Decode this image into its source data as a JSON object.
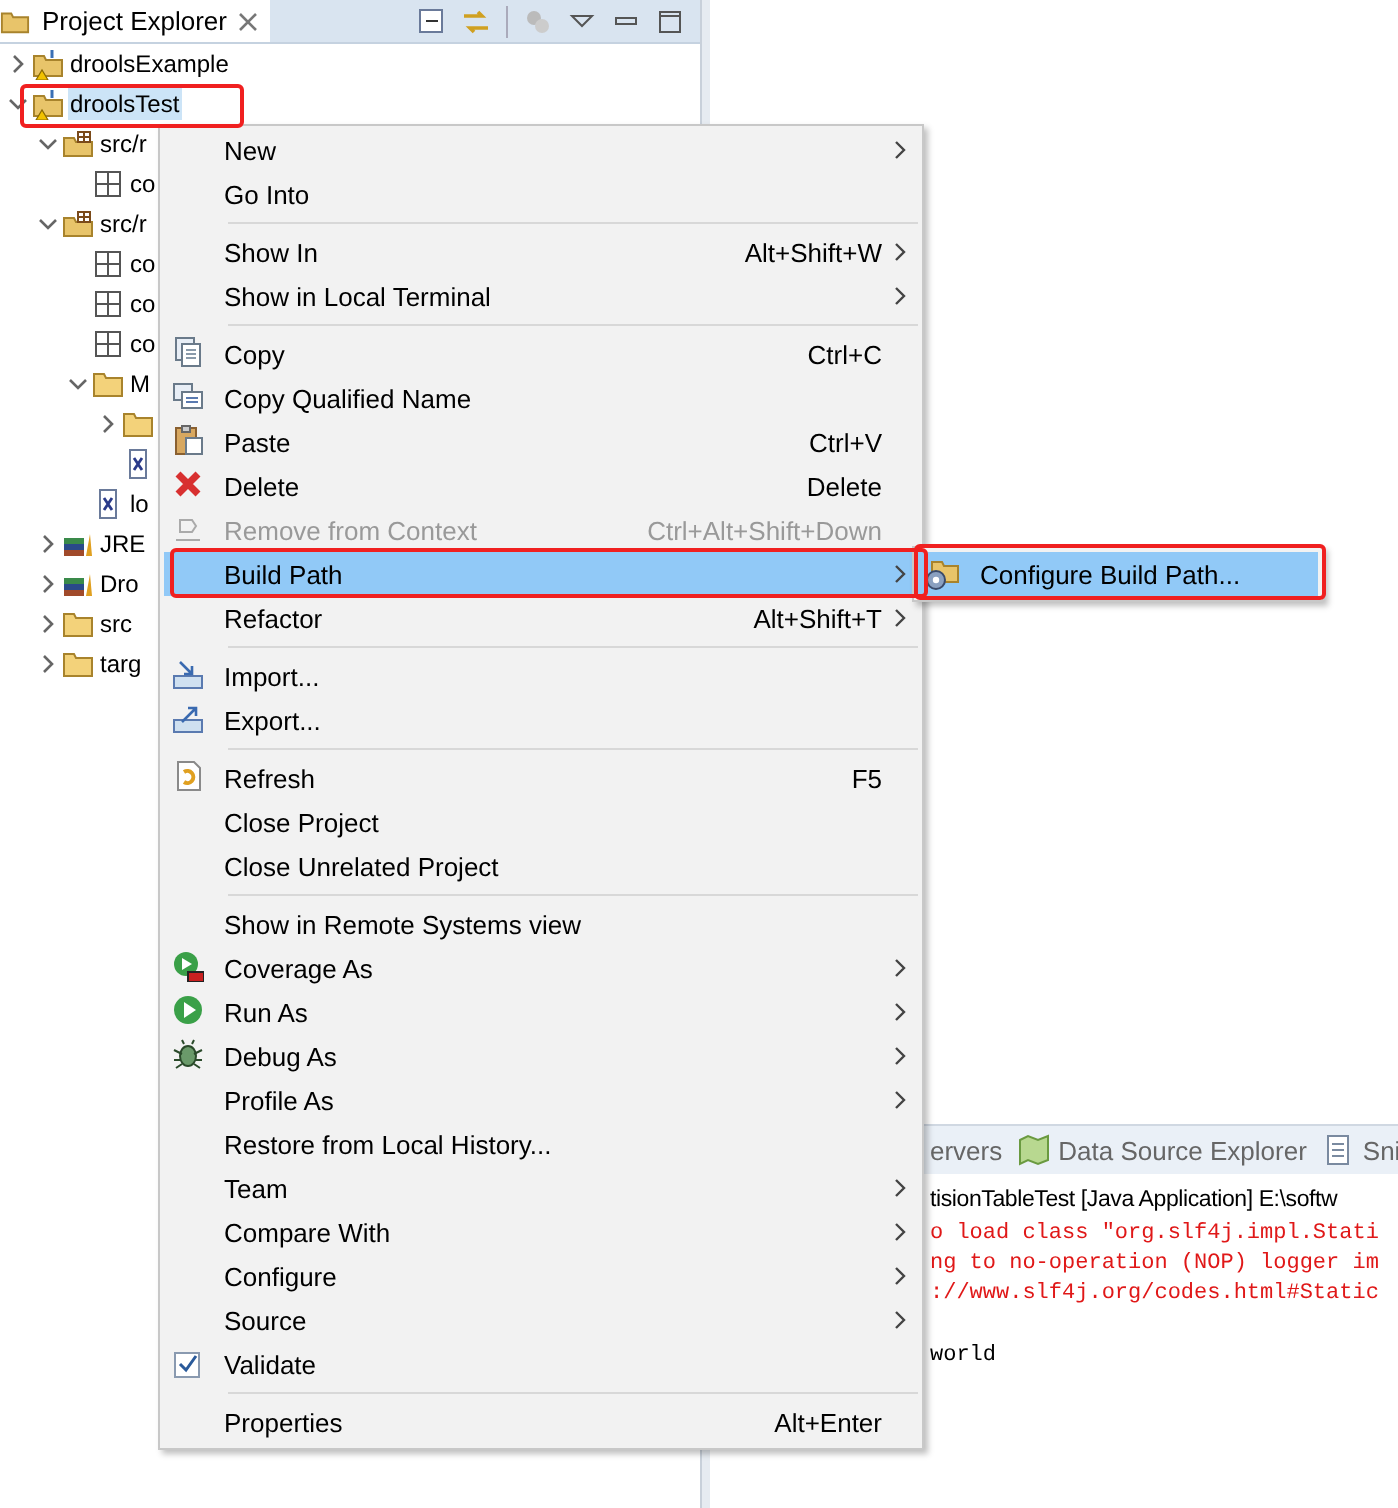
{
  "explorer": {
    "title": "Project Explorer",
    "tree": [
      {
        "label": "droolsExample",
        "kind": "project",
        "expanded": false,
        "selected": false
      },
      {
        "label": "droolsTest",
        "kind": "project",
        "expanded": true,
        "selected": true,
        "children": [
          {
            "label": "src/r",
            "kind": "source-folder",
            "expanded": true,
            "selected": false,
            "children": [
              {
                "label": "co",
                "kind": "package",
                "selected": false
              }
            ]
          },
          {
            "label": "src/r",
            "kind": "source-folder",
            "expanded": true,
            "selected": false,
            "children": [
              {
                "label": "co",
                "kind": "package",
                "selected": false
              },
              {
                "label": "co",
                "kind": "package",
                "selected": false
              },
              {
                "label": "co",
                "kind": "package",
                "selected": false
              },
              {
                "label": "M",
                "kind": "folder",
                "expanded": true,
                "selected": false,
                "children": [
                  {
                    "kind": "folder",
                    "expanded": false,
                    "selected": false
                  },
                  {
                    "kind": "xml",
                    "selected": false
                  }
                ]
              },
              {
                "label": "lo",
                "kind": "xml",
                "selected": false
              }
            ]
          },
          {
            "label": "JRE",
            "kind": "library",
            "expanded": false,
            "selected": false
          },
          {
            "label": "Dro",
            "kind": "library",
            "expanded": false,
            "selected": false
          },
          {
            "label": "src",
            "kind": "folder",
            "expanded": false,
            "selected": false
          },
          {
            "label": "targ",
            "kind": "folder",
            "expanded": false,
            "selected": false
          }
        ]
      }
    ]
  },
  "console": {
    "tabs": [
      {
        "label": "ervers",
        "kind": "plain"
      },
      {
        "label": "Data Source Explorer",
        "kind": "map"
      },
      {
        "label": "Sni",
        "kind": "snippet"
      }
    ],
    "header": "tisionTableTest [Java Application] E:\\softw",
    "lines": [
      {
        "text": "o load class \"org.slf4j.impl.Stati",
        "kind": "error"
      },
      {
        "text": "ng to no-operation (NOP) logger im",
        "kind": "error"
      },
      {
        "text": "://www.slf4j.org/codes.html#Static",
        "kind": "error"
      },
      {
        "text": "world",
        "kind": "output"
      }
    ]
  },
  "context_menu": {
    "items": [
      {
        "kind": "item",
        "label": "New",
        "submenu": true,
        "selected": false
      },
      {
        "kind": "item",
        "label": "Go Into",
        "selected": false
      },
      {
        "kind": "separator"
      },
      {
        "kind": "item",
        "label": "Show In",
        "shortcut": "Alt+Shift+W",
        "submenu": true,
        "selected": false
      },
      {
        "kind": "item",
        "label": "Show in Local Terminal",
        "submenu": true,
        "selected": false
      },
      {
        "kind": "separator"
      },
      {
        "kind": "copy",
        "label": "Copy",
        "shortcut": "Ctrl+C",
        "selected": false
      },
      {
        "kind": "copy-name",
        "label": "Copy Qualified Name",
        "selected": false
      },
      {
        "kind": "paste",
        "label": "Paste",
        "shortcut": "Ctrl+V",
        "selected": false
      },
      {
        "kind": "delete",
        "label": "Delete",
        "shortcut": "Delete",
        "selected": false
      },
      {
        "kind": "remove",
        "label": "Remove from Context",
        "shortcut": "Ctrl+Alt+Shift+Down",
        "disabled": true,
        "selected": false
      },
      {
        "kind": "item",
        "label": "Build Path",
        "submenu": true,
        "selected": true
      },
      {
        "kind": "item",
        "label": "Refactor",
        "shortcut": "Alt+Shift+T",
        "submenu": true,
        "selected": false
      },
      {
        "kind": "separator"
      },
      {
        "kind": "import",
        "label": "Import...",
        "selected": false
      },
      {
        "kind": "export",
        "label": "Export...",
        "selected": false
      },
      {
        "kind": "separator"
      },
      {
        "kind": "refresh",
        "label": "Refresh",
        "shortcut": "F5",
        "selected": false
      },
      {
        "kind": "item",
        "label": "Close Project",
        "selected": false
      },
      {
        "kind": "item",
        "label": "Close Unrelated Project",
        "selected": false
      },
      {
        "kind": "separator"
      },
      {
        "kind": "item",
        "label": "Show in Remote Systems view",
        "selected": false
      },
      {
        "kind": "coverage",
        "label": "Coverage As",
        "submenu": true,
        "selected": false
      },
      {
        "kind": "run",
        "label": "Run As",
        "submenu": true,
        "selected": false
      },
      {
        "kind": "debug",
        "label": "Debug As",
        "submenu": true,
        "selected": false
      },
      {
        "kind": "item",
        "label": "Profile As",
        "submenu": true,
        "selected": false
      },
      {
        "kind": "item",
        "label": "Restore from Local History...",
        "selected": false
      },
      {
        "kind": "item",
        "label": "Team",
        "submenu": true,
        "selected": false
      },
      {
        "kind": "item",
        "label": "Compare With",
        "submenu": true,
        "selected": false
      },
      {
        "kind": "item",
        "label": "Configure",
        "submenu": true,
        "selected": false
      },
      {
        "kind": "item",
        "label": "Source",
        "submenu": true,
        "selected": false
      },
      {
        "kind": "item",
        "label": "Validate",
        "checked": true,
        "selected": false
      },
      {
        "kind": "separator"
      },
      {
        "kind": "item",
        "label": "Properties",
        "shortcut": "Alt+Enter",
        "selected": false
      }
    ]
  },
  "submenu": {
    "items": [
      {
        "label": "Configure Build Path...",
        "selected": true
      }
    ]
  }
}
